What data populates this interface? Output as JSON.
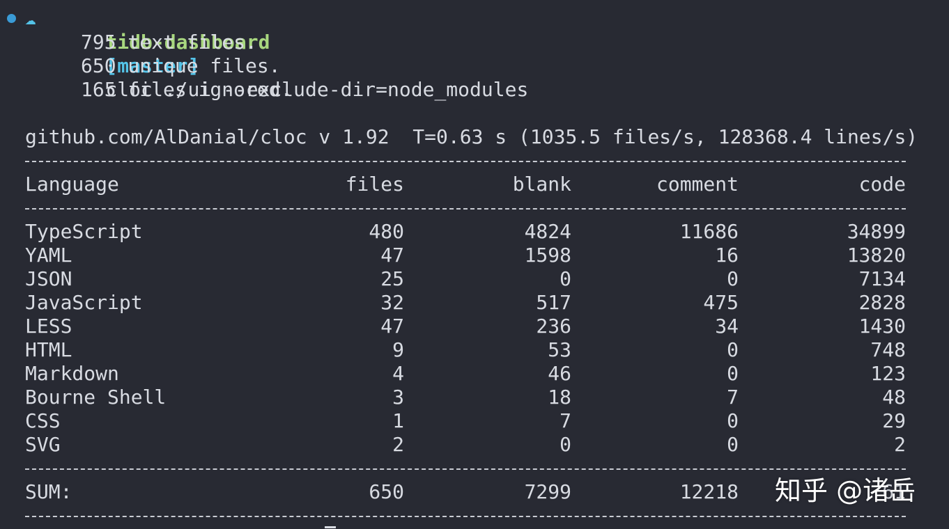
{
  "colors": {
    "background": "#282a33",
    "text": "#d8dbe2",
    "prompt_dir": "#a8d77f",
    "prompt_branch": "#54c3e8",
    "prompt_dot": "#3a9bd6"
  },
  "icons": {
    "status": "status-dot-icon",
    "prompt": "prompt-cloud-icon"
  },
  "prompt": {
    "symbol": "☁",
    "directory": "tidb-dashboard",
    "branch": "[master]",
    "command": "cloc ./ui --exclude-dir=node_modules"
  },
  "output": {
    "summary": [
      "795 text files.",
      "650 unique files.",
      "165 files ignored."
    ],
    "version_line": "github.com/AlDanial/cloc v 1.92  T=0.63 s (1035.5 files/s, 128368.4 lines/s)",
    "separator": "-------------------------------------------------------------------------------"
  },
  "table": {
    "headers": {
      "language": "Language",
      "files": "files",
      "blank": "blank",
      "comment": "comment",
      "code": "code"
    },
    "rows": [
      {
        "language": "TypeScript",
        "files": "480",
        "blank": "4824",
        "comment": "11686",
        "code": "34899"
      },
      {
        "language": "YAML",
        "files": "47",
        "blank": "1598",
        "comment": "16",
        "code": "13820"
      },
      {
        "language": "JSON",
        "files": "25",
        "blank": "0",
        "comment": "0",
        "code": "7134"
      },
      {
        "language": "JavaScript",
        "files": "32",
        "blank": "517",
        "comment": "475",
        "code": "2828"
      },
      {
        "language": "LESS",
        "files": "47",
        "blank": "236",
        "comment": "34",
        "code": "1430"
      },
      {
        "language": "HTML",
        "files": "9",
        "blank": "53",
        "comment": "0",
        "code": "748"
      },
      {
        "language": "Markdown",
        "files": "4",
        "blank": "46",
        "comment": "0",
        "code": "123"
      },
      {
        "language": "Bourne Shell",
        "files": "3",
        "blank": "18",
        "comment": "7",
        "code": "48"
      },
      {
        "language": "CSS",
        "files": "1",
        "blank": "7",
        "comment": "0",
        "code": "29"
      },
      {
        "language": "SVG",
        "files": "2",
        "blank": "0",
        "comment": "0",
        "code": "2"
      }
    ],
    "sum": {
      "language": "SUM:",
      "files": "650",
      "blank": "7299",
      "comment": "12218",
      "code": "61"
    }
  },
  "watermark": "知乎 @诸岳"
}
